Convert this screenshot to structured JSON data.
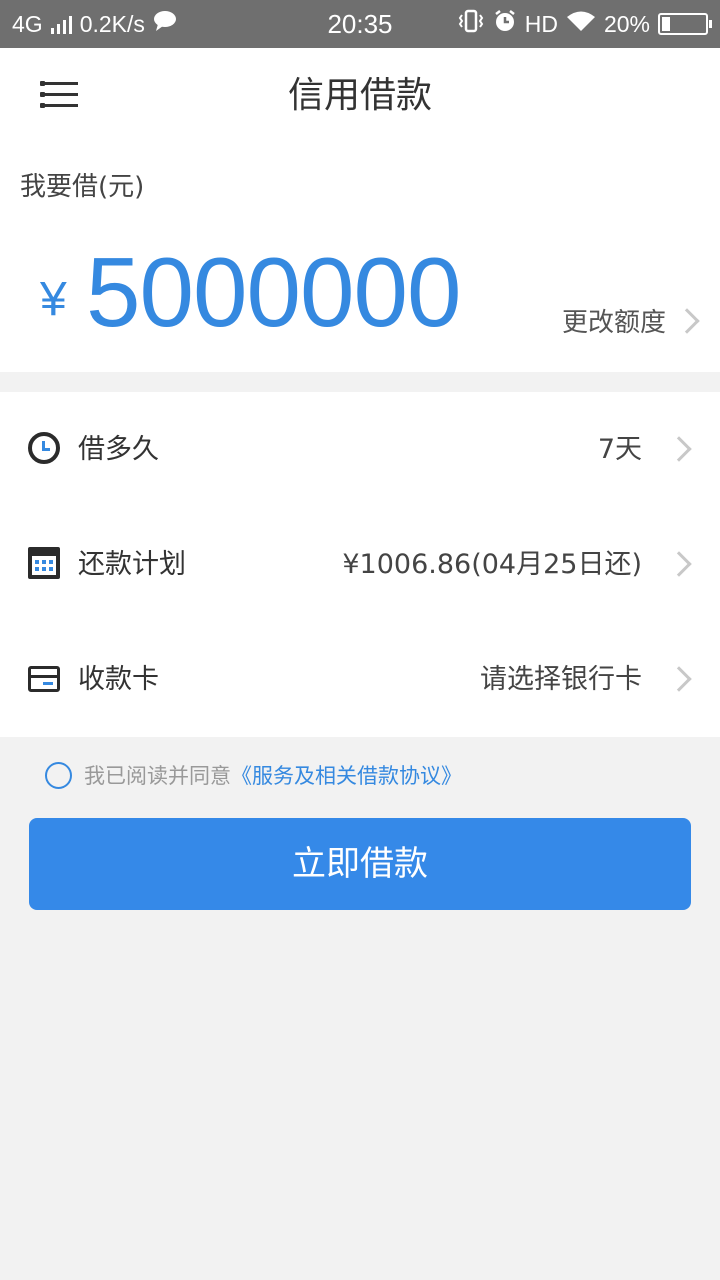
{
  "status_bar": {
    "network": "4G",
    "speed": "0.2K/s",
    "time": "20:35",
    "hd": "HD",
    "battery": "20%",
    "battery_level": 0.2
  },
  "header": {
    "title": "信用借款",
    "menu_icon": "menu-icon"
  },
  "amount": {
    "label": "我要借(元)",
    "currency": "¥",
    "value": "5000000",
    "change_limit": "更改额度"
  },
  "rows": [
    {
      "icon": "clock-icon",
      "label": "借多久",
      "value": "7天"
    },
    {
      "icon": "calendar-icon",
      "label": "还款计划",
      "value": "¥1006.86(04月25日还)"
    },
    {
      "icon": "bank-card-icon",
      "label": "收款卡",
      "value": "请选择银行卡"
    }
  ],
  "agreement": {
    "text": "我已阅读并同意",
    "link": "《服务及相关借款协议》"
  },
  "submit_label": "立即借款",
  "colors": {
    "accent": "#3589e0",
    "button": "#3589e8",
    "status_bar": "#6f6f6f",
    "background": "#f2f2f2"
  }
}
